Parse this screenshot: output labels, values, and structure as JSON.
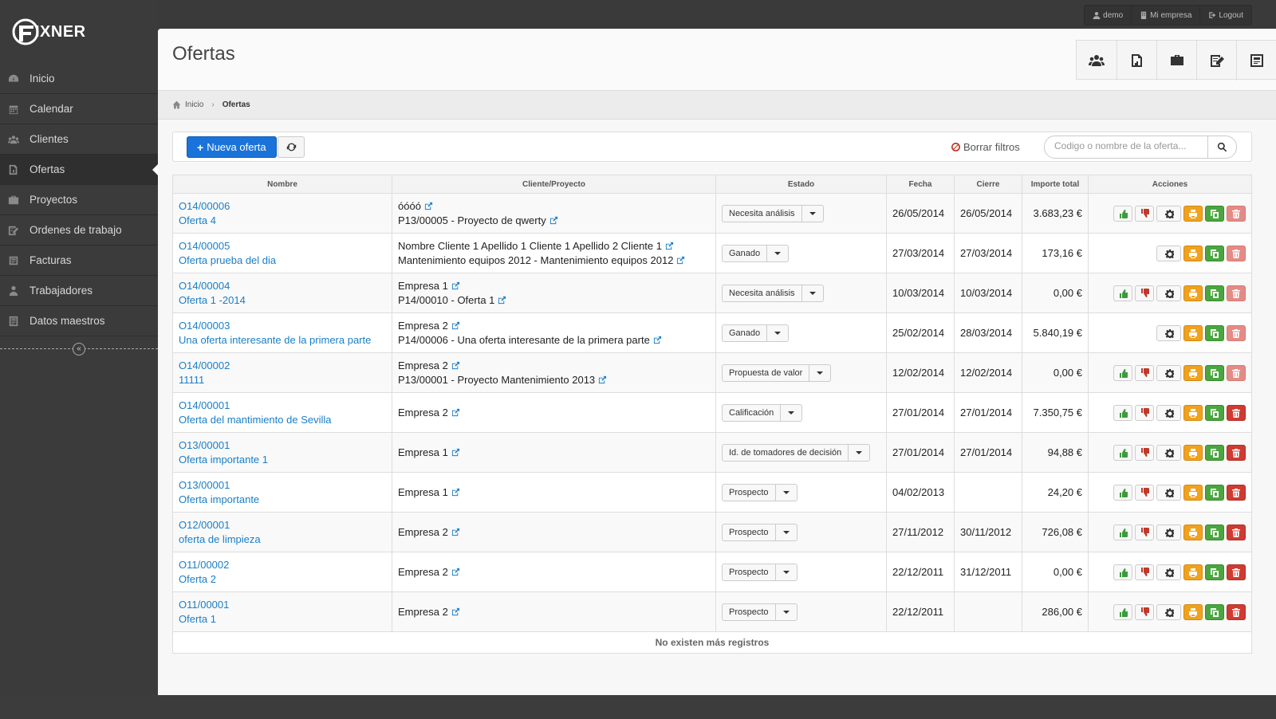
{
  "app": {
    "logo_text": "IXNER"
  },
  "userbar": {
    "user": "demo",
    "company": "Mi empresa",
    "logout": "Logout"
  },
  "sidebar": {
    "items": [
      {
        "label": "Inicio",
        "icon": "dashboard-icon"
      },
      {
        "label": "Calendar",
        "icon": "calendar-icon"
      },
      {
        "label": "Clientes",
        "icon": "clients-icon"
      },
      {
        "label": "Ofertas",
        "icon": "offers-icon",
        "active": true
      },
      {
        "label": "Proyectos",
        "icon": "briefcase-icon"
      },
      {
        "label": "Ordenes de trabajo",
        "icon": "work-order-icon"
      },
      {
        "label": "Facturas",
        "icon": "invoice-icon"
      },
      {
        "label": "Trabajadores",
        "icon": "worker-icon"
      },
      {
        "label": "Datos maestros",
        "icon": "master-data-icon"
      }
    ]
  },
  "page": {
    "title": "Ofertas"
  },
  "breadcrumb": {
    "home": "Inicio",
    "current": "Ofertas"
  },
  "toolbar": {
    "new_label": "Nueva oferta",
    "clear_filters": "Borrar filtros",
    "search_placeholder": "Codigo o nombre de la oferta..."
  },
  "table": {
    "headers": {
      "name": "Nombre",
      "client": "Cliente/Proyecto",
      "status": "Estado",
      "date": "Fecha",
      "close": "Cierre",
      "total": "Importe total",
      "actions": "Acciones"
    },
    "rows": [
      {
        "code": "O14/00006",
        "name": "Oferta 4",
        "client": "óóóó",
        "project": "P13/00005 - Proyecto de qwerty",
        "status": "Necesita análisis",
        "date": "26/05/2014",
        "close": "26/05/2014",
        "total": "3.683,23 €"
      },
      {
        "code": "O14/00005",
        "name": "Oferta prueba del dia",
        "client": "Nombre Cliente 1 Apellido 1 Cliente 1 Apellido 2 Cliente 1",
        "project": "Mantenimiento equipos 2012 - Mantenimiento equipos 2012",
        "status": "Ganado",
        "date": "27/03/2014",
        "close": "27/03/2014",
        "total": "173,16 €"
      },
      {
        "code": "O14/00004",
        "name": "Oferta 1 -2014",
        "client": "Empresa 1",
        "project": "P14/00010 - Oferta 1",
        "status": "Necesita análisis",
        "date": "10/03/2014",
        "close": "10/03/2014",
        "total": "0,00 €"
      },
      {
        "code": "O14/00003",
        "name": "Una oferta interesante de la primera parte",
        "client": "Empresa 2",
        "project": "P14/00006 - Una oferta interesante de la primera parte",
        "status": "Ganado",
        "date": "25/02/2014",
        "close": "28/03/2014",
        "total": "5.840,19 €"
      },
      {
        "code": "O14/00002",
        "name": "11111",
        "client": "Empresa 2",
        "project": "P13/00001 - Proyecto Mantenimiento 2013",
        "status": "Propuesta de valor",
        "date": "12/02/2014",
        "close": "12/02/2014",
        "total": "0,00 €"
      },
      {
        "code": "O14/00001",
        "name": "Oferta del mantimiento de Sevilla",
        "client": "Empresa 2",
        "project": "",
        "status": "Calificación",
        "date": "27/01/2014",
        "close": "27/01/2014",
        "total": "7.350,75 €"
      },
      {
        "code": "O13/00001",
        "name": "Oferta importante 1",
        "client": "Empresa 1",
        "project": "",
        "status": "Id. de tomadores de decisión",
        "date": "27/01/2014",
        "close": "27/01/2014",
        "total": "94,88 €"
      },
      {
        "code": "O13/00001",
        "name": "Oferta importante",
        "client": "Empresa 1",
        "project": "",
        "status": "Prospecto",
        "date": "04/02/2013",
        "close": "",
        "total": "24,20 €"
      },
      {
        "code": "O12/00001",
        "name": "oferta de limpieza",
        "client": "Empresa 2",
        "project": "",
        "status": "Prospecto",
        "date": "27/11/2012",
        "close": "30/11/2012",
        "total": "726,08 €"
      },
      {
        "code": "O11/00002",
        "name": "Oferta 2",
        "client": "Empresa 2",
        "project": "",
        "status": "Prospecto",
        "date": "22/12/2011",
        "close": "31/12/2011",
        "total": "0,00 €"
      },
      {
        "code": "O11/00001",
        "name": "Oferta 1",
        "client": "Empresa 2",
        "project": "",
        "status": "Prospecto",
        "date": "22/12/2011",
        "close": "",
        "total": "286,00 €"
      }
    ],
    "footer": "No existen más registros"
  },
  "colors": {
    "primary": "#1a73d9",
    "link": "#1a7ec7",
    "print": "#f0a21e",
    "copy": "#4aa63f",
    "delete": "#cf3b32"
  }
}
